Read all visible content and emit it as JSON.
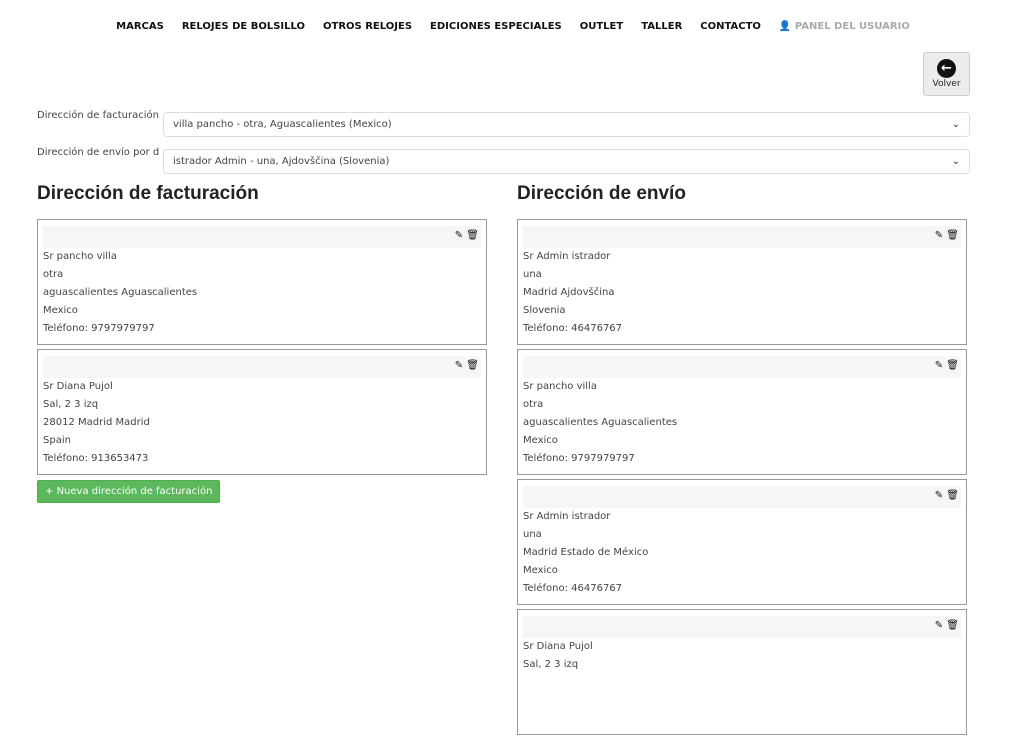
{
  "nav": [
    "MARCAS",
    "RELOJES DE BOLSILLO",
    "OTROS RELOJES",
    "EDICIONES ESPECIALES",
    "OUTLET",
    "TALLER",
    "CONTACTO"
  ],
  "nav_user": "PANEL DEL USUARIO",
  "back_label": "Volver",
  "billing_select": {
    "label": "Dirección de facturación",
    "value": "villa pancho - otra, Aguascalientes (Mexico)"
  },
  "shipping_select": {
    "label": "Dirección de envío por defecto",
    "value": "istrador Admin - una, Ajdovščina (Slovenia)"
  },
  "billing": {
    "title": "Dirección de facturación",
    "add_label": "Nueva dirección de facturación",
    "cards": [
      [
        "Sr pancho villa",
        "otra",
        "aguascalientes Aguascalientes",
        "Mexico",
        "Teléfono: 9797979797"
      ],
      [
        "Sr Diana Pujol",
        "Sal, 2 3 izq",
        "28012 Madrid Madrid",
        "Spain",
        "Teléfono: 913653473"
      ]
    ]
  },
  "shipping": {
    "title": "Dirección de envío",
    "cards": [
      [
        "Sr Admin istrador",
        "una",
        "Madrid Ajdovščina",
        "Slovenia",
        "Teléfono: 46476767"
      ],
      [
        "Sr pancho villa",
        "otra",
        "aguascalientes Aguascalientes",
        "Mexico",
        "Teléfono: 9797979797"
      ],
      [
        "Sr Admin istrador",
        "una",
        "Madrid Estado de México",
        "Mexico",
        "Teléfono: 46476767"
      ],
      [
        "Sr Diana Pujol",
        "Sal, 2 3 izq",
        "",
        "",
        ""
      ]
    ]
  }
}
